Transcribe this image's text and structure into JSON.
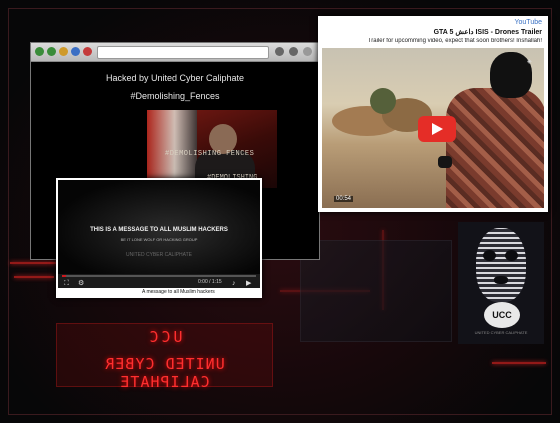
{
  "browser": {
    "page_header": "Hacked by United Cyber Caliphate",
    "page_hashtag": "#Demolishing_Fences",
    "image": {
      "caption_top": "#DEMOLISHING FENCES",
      "caption_bottom": "#DEMOLISHING FENCES"
    }
  },
  "video_player": {
    "headline": "THIS IS A MESSAGE TO ALL MUSLIM HACKERS",
    "subline": "BE IT LONE WOLF OR HACKING GROUP",
    "lower_line": "UNITED CYBER CALIPHATE",
    "time": "0:00 / 1:15",
    "progress": 0.02,
    "caption": "A message to all Muslim hackers"
  },
  "youtube_card": {
    "source_label": "YouTube",
    "title": "GTA 5 داعش ISIS - Drones Trailer",
    "description": "Trailer for upcomming video, expect that soon brothers! Inshallah!",
    "duration": "00:54"
  },
  "logo": {
    "badge_text": "UCC",
    "badge_subtext": "UNITED CYBER CALIPHATE"
  },
  "sign": {
    "acronym": "UCC",
    "full_name": "UNITED CYBER CALIPHATE"
  },
  "colors": {
    "accent_red": "#ff2f2f",
    "youtube_red": "#e52d27",
    "link_blue": "#3b72c4"
  },
  "icons": [
    "play-icon",
    "volume-icon",
    "fullscreen-icon",
    "settings-icon"
  ]
}
